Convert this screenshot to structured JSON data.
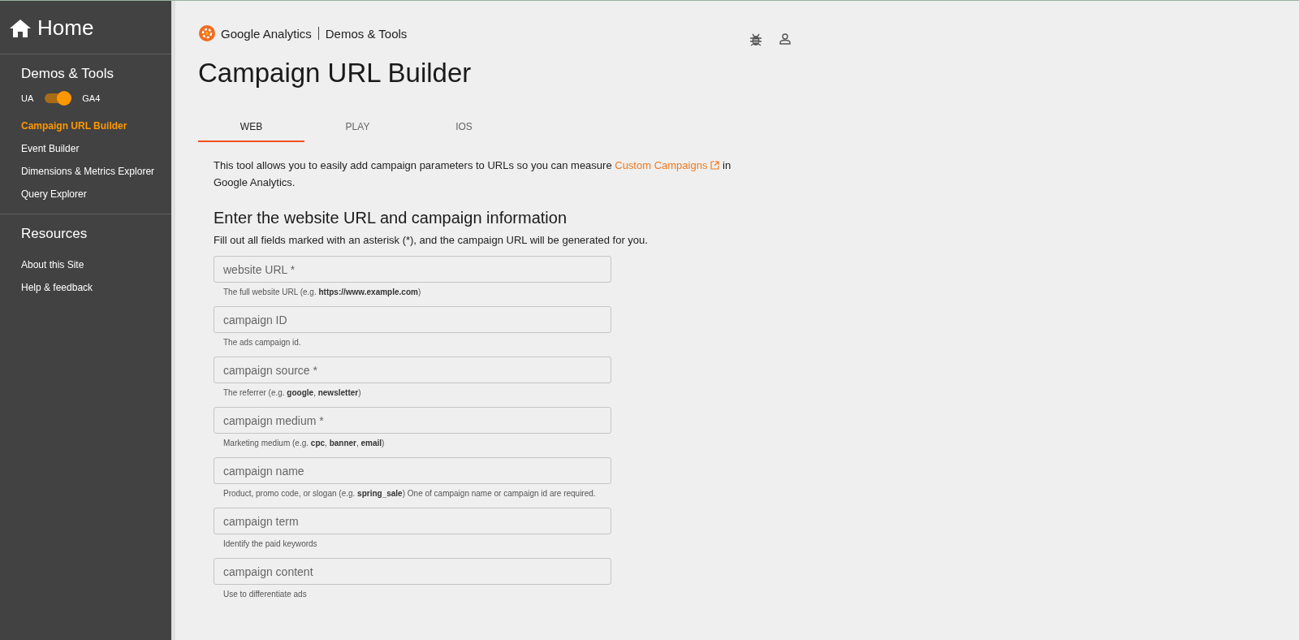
{
  "sidebar": {
    "home": "Home",
    "sections": [
      {
        "title": "Demos & Tools",
        "toggle": {
          "left_label": "UA",
          "right_label": "GA4",
          "on": true
        },
        "items": [
          {
            "label": "Campaign URL Builder",
            "selected": true
          },
          {
            "label": "Event Builder",
            "selected": false
          },
          {
            "label": "Dimensions & Metrics Explorer",
            "selected": false
          },
          {
            "label": "Query Explorer",
            "selected": false
          }
        ]
      },
      {
        "title": "Resources",
        "items": [
          {
            "label": "About this Site",
            "selected": false
          },
          {
            "label": "Help & feedback",
            "selected": false
          }
        ]
      }
    ]
  },
  "header": {
    "brand": "Google Analytics",
    "product": "Demos & Tools"
  },
  "title": "Campaign URL Builder",
  "tabs": [
    {
      "label": "WEB",
      "selected": true
    },
    {
      "label": "PLAY",
      "selected": false
    },
    {
      "label": "IOS",
      "selected": false
    }
  ],
  "intro": {
    "before": "This tool allows you to easily add campaign parameters to URLs so you can measure ",
    "link": "Custom Campaigns",
    "after": " in Google Analytics."
  },
  "section_heading": "Enter the website URL and campaign information",
  "instructions": "Fill out all fields marked with an asterisk (*), and the campaign URL will be generated for you.",
  "fields": [
    {
      "placeholder": "website URL *",
      "helper": "The full website URL (e.g. **https://www.example.com**)"
    },
    {
      "placeholder": "campaign ID",
      "helper": "The ads campaign id."
    },
    {
      "placeholder": "campaign source *",
      "helper": "The referrer (e.g. **google**, **newsletter**)"
    },
    {
      "placeholder": "campaign medium *",
      "helper": "Marketing medium (e.g. **cpc**, **banner**, **email**)"
    },
    {
      "placeholder": "campaign name",
      "helper": "Product, promo code, or slogan (e.g. **spring_sale**) One of campaign name or campaign id are required."
    },
    {
      "placeholder": "campaign term",
      "helper": "Identify the paid keywords"
    },
    {
      "placeholder": "campaign content",
      "helper": "Use to differentiate ads"
    }
  ]
}
